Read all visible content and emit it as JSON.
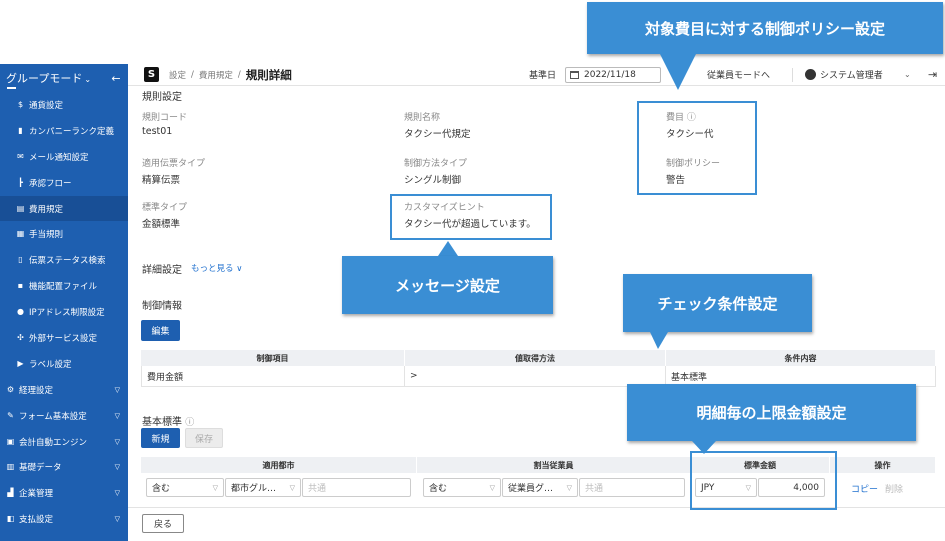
{
  "sidebar": {
    "mode_label": "グループモード",
    "mode_caret": "⌄",
    "collapse_icon": "←",
    "items": [
      {
        "label": "通貨設定",
        "icon": "currency-icon"
      },
      {
        "label": "カンパニーランク定義",
        "icon": "rank-icon"
      },
      {
        "label": "メール通知設定",
        "icon": "mail-icon"
      },
      {
        "label": "承認フロー",
        "icon": "flow-icon"
      },
      {
        "label": "費用規定",
        "icon": "rule-icon",
        "active": true
      },
      {
        "label": "手当規則",
        "icon": "allowance-icon"
      },
      {
        "label": "伝票ステータス検索",
        "icon": "document-icon"
      },
      {
        "label": "機能配置ファイル",
        "icon": "grid-icon"
      },
      {
        "label": "IPアドレス制限設定",
        "icon": "ip-icon"
      },
      {
        "label": "外部サービス設定",
        "icon": "external-icon"
      },
      {
        "label": "ラベル設定",
        "icon": "label-icon"
      }
    ],
    "sections": [
      {
        "label": "経理設定",
        "icon": "accounting-icon"
      },
      {
        "label": "フォーム基本設定",
        "icon": "wrench-icon"
      },
      {
        "label": "会計自動エンジン",
        "icon": "engine-icon"
      },
      {
        "label": "基礎データ",
        "icon": "data-icon"
      },
      {
        "label": "企業管理",
        "icon": "company-icon"
      },
      {
        "label": "支払設定",
        "icon": "payment-icon"
      }
    ]
  },
  "topbar": {
    "breadcrumb": [
      "設定",
      "費用規定"
    ],
    "separator": "/",
    "page_title": "規則詳細",
    "base_date_label": "基準日",
    "base_date_value": "2022/11/18",
    "employee_mode": "従業員モードへ",
    "user_name": "システム管理者",
    "user_caret": "⌄",
    "logout_icon": "⇥"
  },
  "rule": {
    "section_title": "規則設定",
    "code_label": "規則コード",
    "code_value": "test01",
    "name_label": "規則名称",
    "name_value": "タクシー代規定",
    "item_label": "費目",
    "info_mark": "ⓘ",
    "item_value": "タクシー代",
    "voucher_type_label": "適用伝票タイプ",
    "voucher_type_value": "精算伝票",
    "control_type_label": "制御方法タイプ",
    "control_type_value": "シングル制御",
    "policy_label": "制御ポリシー",
    "policy_value": "警告",
    "standard_type_label": "標準タイプ",
    "standard_type_value": "金額標準",
    "hint_label": "カスタマイズヒント",
    "hint_value": "タクシー代が超過しています。"
  },
  "detail": {
    "title": "詳細設定",
    "more_link": "もっと見る ∨"
  },
  "control": {
    "title": "制御情報",
    "edit_button": "編集",
    "headers": [
      "制御項目",
      "値取得方法",
      "条件内容"
    ],
    "row": [
      "費用金額",
      ">",
      "基本標準"
    ]
  },
  "standard": {
    "title": "基本標準",
    "new_button": "新規",
    "save_button": "保存",
    "headers": [
      "適用都市",
      "割当従業員",
      "標準金額",
      "操作"
    ],
    "row": {
      "city_include": "含む",
      "city_group": "都市グル…",
      "city_common_placeholder": "共通",
      "emp_include": "含む",
      "emp_group": "従業員グ…",
      "emp_common_placeholder": "共通",
      "currency": "JPY",
      "amount": "4,000",
      "copy_link": "コピー",
      "delete_link": "削除"
    }
  },
  "footer": {
    "back_button": "戻る"
  },
  "annotations": {
    "policy_callout": "対象費目に対する制御ポリシー設定",
    "message_callout": "メッセージ設定",
    "check_callout": "チェック条件設定",
    "limit_callout": "明細毎の上限金額設定",
    "accent_color": "#3a8ed4"
  },
  "colors": {
    "sidebar": "#1e5fb0",
    "primary_button": "#1e5fb0",
    "link": "#1e6fce"
  }
}
